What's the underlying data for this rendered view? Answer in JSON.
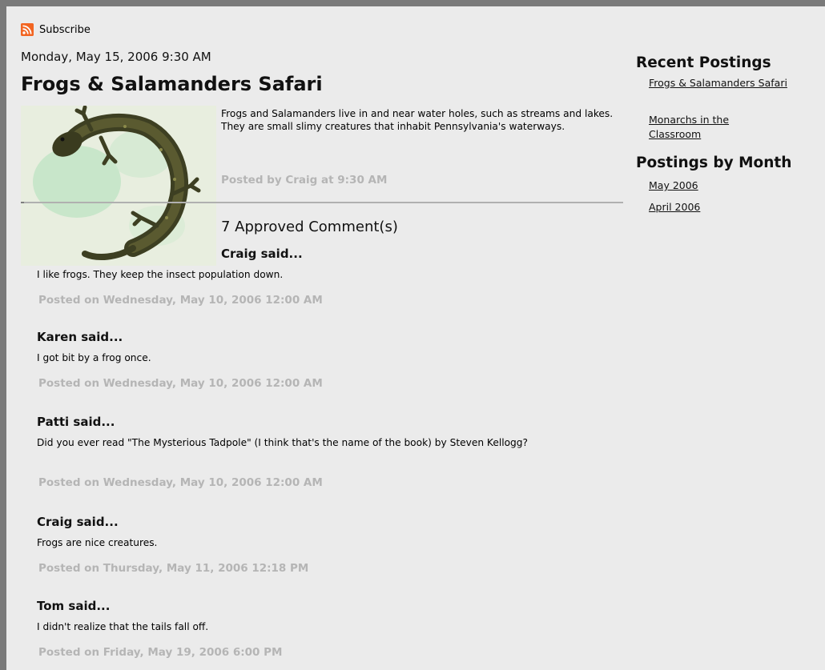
{
  "subscribe": {
    "icon": "rss-feed-icon",
    "label": "Subscribe",
    "icon_color": "#f26522"
  },
  "post": {
    "date": "Monday, May 15, 2006 9:30 AM",
    "title": "Frogs & Salamanders Safari",
    "image": "salamander-image",
    "body": "Frogs and Salamanders live in and near water holes, such as streams and lakes. They are small slimy creatures that inhabit Pennsylvania's waterways.",
    "posted_by": "Posted by Craig at 9:30 AM"
  },
  "comments": {
    "heading": "7 Approved Comment(s)",
    "items": [
      {
        "author": "Craig said...",
        "text": "I like frogs. They keep the insect population down.",
        "meta": "Posted on Wednesday, May 10, 2006 12:00 AM"
      },
      {
        "author": "Karen said...",
        "text": "I got bit by a frog once.",
        "meta": "Posted on Wednesday, May 10, 2006 12:00 AM"
      },
      {
        "author": "Patti said...",
        "text": "Did you ever read \"The Mysterious Tadpole\" (I think that's the name of the book) by Steven Kellogg?",
        "meta": "Posted on Wednesday, May 10, 2006 12:00 AM"
      },
      {
        "author": "Craig said...",
        "text": "Frogs are nice creatures.",
        "meta": "Posted on Thursday, May 11, 2006 12:18 PM"
      },
      {
        "author": "Tom said...",
        "text": "I didn't realize that the tails fall off.",
        "meta": "Posted on Friday, May 19, 2006 6:00 PM"
      }
    ]
  },
  "sidebar": {
    "recent_heading": "Recent Postings",
    "recent_links": [
      "Frogs & Salamanders Safari",
      "Monarchs in the Classroom"
    ],
    "month_heading": "Postings by Month",
    "month_links": [
      "May 2006",
      "April 2006"
    ]
  },
  "colors": {
    "page_bg": "#ebebeb",
    "frame": "#7a7a7a",
    "muted_text": "#b5b5b5",
    "rss_orange": "#f26522"
  }
}
